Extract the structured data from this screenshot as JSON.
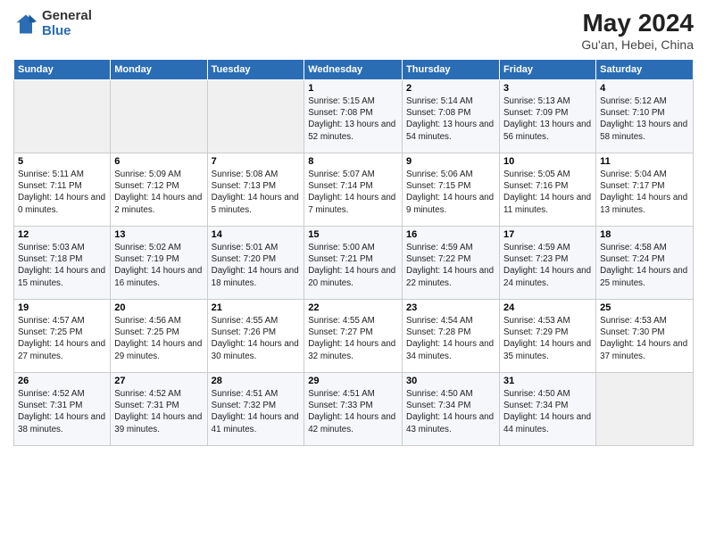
{
  "header": {
    "logo_line1": "General",
    "logo_line2": "Blue",
    "month": "May 2024",
    "location": "Gu'an, Hebei, China"
  },
  "weekdays": [
    "Sunday",
    "Monday",
    "Tuesday",
    "Wednesday",
    "Thursday",
    "Friday",
    "Saturday"
  ],
  "weeks": [
    [
      {
        "day": "",
        "info": ""
      },
      {
        "day": "",
        "info": ""
      },
      {
        "day": "",
        "info": ""
      },
      {
        "day": "1",
        "info": "Sunrise: 5:15 AM\nSunset: 7:08 PM\nDaylight: 13 hours and 52 minutes."
      },
      {
        "day": "2",
        "info": "Sunrise: 5:14 AM\nSunset: 7:08 PM\nDaylight: 13 hours and 54 minutes."
      },
      {
        "day": "3",
        "info": "Sunrise: 5:13 AM\nSunset: 7:09 PM\nDaylight: 13 hours and 56 minutes."
      },
      {
        "day": "4",
        "info": "Sunrise: 5:12 AM\nSunset: 7:10 PM\nDaylight: 13 hours and 58 minutes."
      }
    ],
    [
      {
        "day": "5",
        "info": "Sunrise: 5:11 AM\nSunset: 7:11 PM\nDaylight: 14 hours and 0 minutes."
      },
      {
        "day": "6",
        "info": "Sunrise: 5:09 AM\nSunset: 7:12 PM\nDaylight: 14 hours and 2 minutes."
      },
      {
        "day": "7",
        "info": "Sunrise: 5:08 AM\nSunset: 7:13 PM\nDaylight: 14 hours and 5 minutes."
      },
      {
        "day": "8",
        "info": "Sunrise: 5:07 AM\nSunset: 7:14 PM\nDaylight: 14 hours and 7 minutes."
      },
      {
        "day": "9",
        "info": "Sunrise: 5:06 AM\nSunset: 7:15 PM\nDaylight: 14 hours and 9 minutes."
      },
      {
        "day": "10",
        "info": "Sunrise: 5:05 AM\nSunset: 7:16 PM\nDaylight: 14 hours and 11 minutes."
      },
      {
        "day": "11",
        "info": "Sunrise: 5:04 AM\nSunset: 7:17 PM\nDaylight: 14 hours and 13 minutes."
      }
    ],
    [
      {
        "day": "12",
        "info": "Sunrise: 5:03 AM\nSunset: 7:18 PM\nDaylight: 14 hours and 15 minutes."
      },
      {
        "day": "13",
        "info": "Sunrise: 5:02 AM\nSunset: 7:19 PM\nDaylight: 14 hours and 16 minutes."
      },
      {
        "day": "14",
        "info": "Sunrise: 5:01 AM\nSunset: 7:20 PM\nDaylight: 14 hours and 18 minutes."
      },
      {
        "day": "15",
        "info": "Sunrise: 5:00 AM\nSunset: 7:21 PM\nDaylight: 14 hours and 20 minutes."
      },
      {
        "day": "16",
        "info": "Sunrise: 4:59 AM\nSunset: 7:22 PM\nDaylight: 14 hours and 22 minutes."
      },
      {
        "day": "17",
        "info": "Sunrise: 4:59 AM\nSunset: 7:23 PM\nDaylight: 14 hours and 24 minutes."
      },
      {
        "day": "18",
        "info": "Sunrise: 4:58 AM\nSunset: 7:24 PM\nDaylight: 14 hours and 25 minutes."
      }
    ],
    [
      {
        "day": "19",
        "info": "Sunrise: 4:57 AM\nSunset: 7:25 PM\nDaylight: 14 hours and 27 minutes."
      },
      {
        "day": "20",
        "info": "Sunrise: 4:56 AM\nSunset: 7:25 PM\nDaylight: 14 hours and 29 minutes."
      },
      {
        "day": "21",
        "info": "Sunrise: 4:55 AM\nSunset: 7:26 PM\nDaylight: 14 hours and 30 minutes."
      },
      {
        "day": "22",
        "info": "Sunrise: 4:55 AM\nSunset: 7:27 PM\nDaylight: 14 hours and 32 minutes."
      },
      {
        "day": "23",
        "info": "Sunrise: 4:54 AM\nSunset: 7:28 PM\nDaylight: 14 hours and 34 minutes."
      },
      {
        "day": "24",
        "info": "Sunrise: 4:53 AM\nSunset: 7:29 PM\nDaylight: 14 hours and 35 minutes."
      },
      {
        "day": "25",
        "info": "Sunrise: 4:53 AM\nSunset: 7:30 PM\nDaylight: 14 hours and 37 minutes."
      }
    ],
    [
      {
        "day": "26",
        "info": "Sunrise: 4:52 AM\nSunset: 7:31 PM\nDaylight: 14 hours and 38 minutes."
      },
      {
        "day": "27",
        "info": "Sunrise: 4:52 AM\nSunset: 7:31 PM\nDaylight: 14 hours and 39 minutes."
      },
      {
        "day": "28",
        "info": "Sunrise: 4:51 AM\nSunset: 7:32 PM\nDaylight: 14 hours and 41 minutes."
      },
      {
        "day": "29",
        "info": "Sunrise: 4:51 AM\nSunset: 7:33 PM\nDaylight: 14 hours and 42 minutes."
      },
      {
        "day": "30",
        "info": "Sunrise: 4:50 AM\nSunset: 7:34 PM\nDaylight: 14 hours and 43 minutes."
      },
      {
        "day": "31",
        "info": "Sunrise: 4:50 AM\nSunset: 7:34 PM\nDaylight: 14 hours and 44 minutes."
      },
      {
        "day": "",
        "info": ""
      }
    ]
  ]
}
